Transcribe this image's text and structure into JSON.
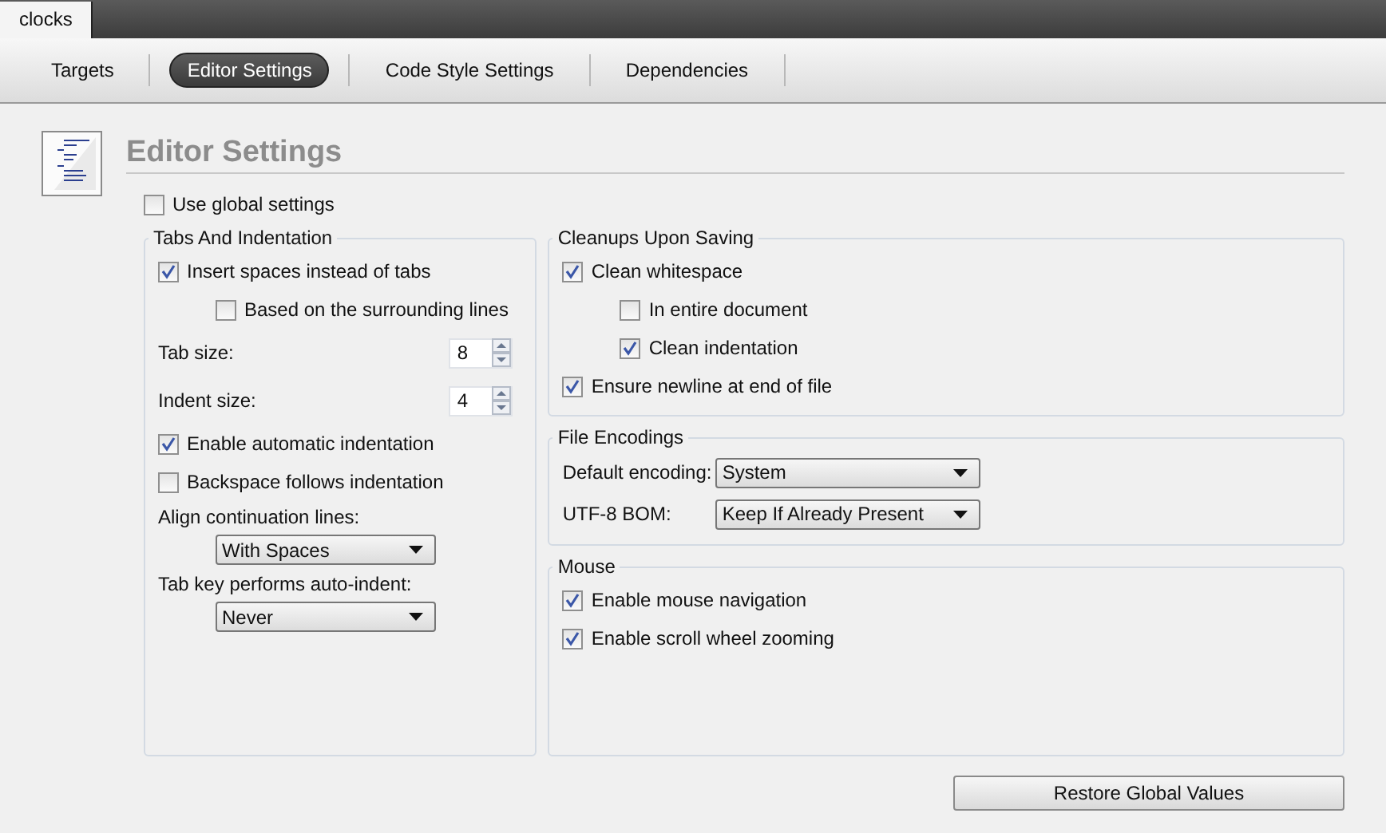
{
  "project_tab": {
    "label": "clocks"
  },
  "nav_tabs": [
    {
      "label": "Targets",
      "selected": false
    },
    {
      "label": "Editor Settings",
      "selected": true
    },
    {
      "label": "Code Style Settings",
      "selected": false
    },
    {
      "label": "Dependencies",
      "selected": false
    }
  ],
  "title": "Editor Settings",
  "use_global": {
    "label": "Use global settings",
    "checked": false
  },
  "columns": [
    [
      {
        "title": "Tabs And Indentation",
        "items": [
          {
            "kind": "checkbox",
            "label": "Insert spaces instead of tabs",
            "checked": true,
            "children": [
              {
                "kind": "checkbox",
                "label": "Based on the surrounding lines",
                "checked": false
              }
            ]
          },
          {
            "kind": "spin",
            "label": "Tab size:",
            "value": "8"
          },
          {
            "kind": "spin",
            "label": "Indent size:",
            "value": "4"
          },
          {
            "kind": "checkbox",
            "label": "Enable automatic indentation",
            "checked": true
          },
          {
            "kind": "checkbox",
            "label": "Backspace follows indentation",
            "checked": false
          },
          {
            "kind": "dropdown",
            "label": "Align continuation lines:",
            "value": "With Spaces"
          },
          {
            "kind": "dropdown",
            "label": "Tab key performs auto-indent:",
            "value": "Never"
          }
        ]
      }
    ],
    [
      {
        "title": "Cleanups Upon Saving",
        "items": [
          {
            "kind": "checkbox",
            "label": "Clean whitespace",
            "checked": true,
            "children": [
              {
                "kind": "checkbox",
                "label": "In entire document",
                "checked": false
              },
              {
                "kind": "checkbox",
                "label": "Clean indentation",
                "checked": true
              }
            ]
          },
          {
            "kind": "checkbox",
            "label": "Ensure newline at end of file",
            "checked": true
          }
        ]
      },
      {
        "title": "File Encodings",
        "items": [
          {
            "kind": "combo",
            "label": "Default encoding:",
            "value": "System"
          },
          {
            "kind": "combo",
            "label": "UTF-8 BOM:",
            "value": "Keep If Already Present"
          }
        ]
      },
      {
        "title": "Mouse",
        "items": [
          {
            "kind": "checkbox",
            "label": "Enable mouse navigation",
            "checked": true
          },
          {
            "kind": "checkbox",
            "label": "Enable scroll wheel zooming",
            "checked": true
          }
        ]
      }
    ]
  ],
  "restore_button": "Restore Global Values"
}
